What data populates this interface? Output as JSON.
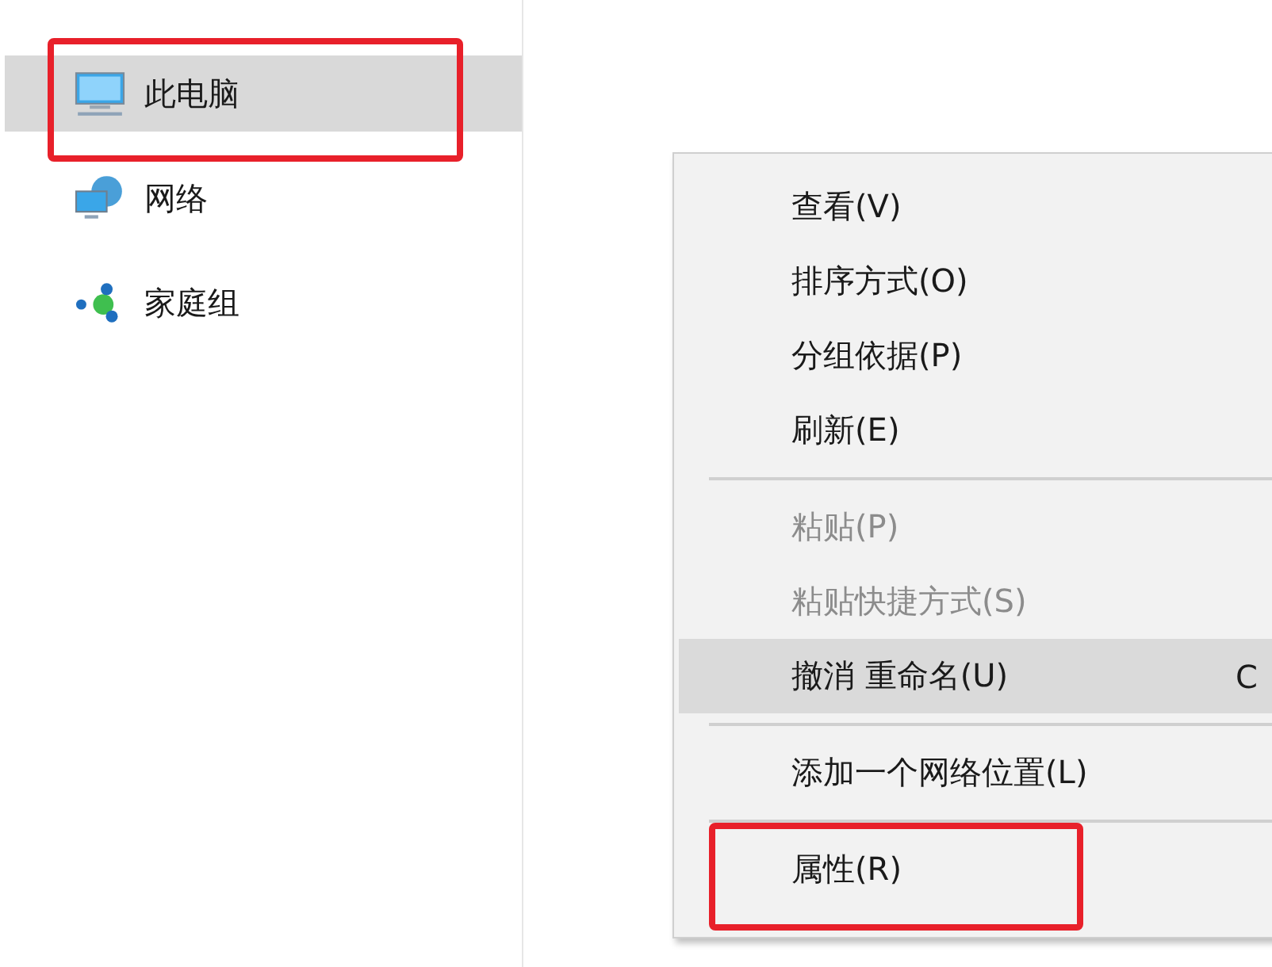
{
  "sidebar": {
    "items": [
      {
        "label": "此电脑",
        "kind": "computer",
        "selected": true,
        "annotated": true
      },
      {
        "label": "网络",
        "kind": "network",
        "selected": false,
        "annotated": false
      },
      {
        "label": "家庭组",
        "kind": "homegroup",
        "selected": false,
        "annotated": false
      }
    ]
  },
  "context_menu": {
    "items": [
      {
        "kind": "item",
        "label": "查看(V)",
        "disabled": false,
        "selected": false,
        "annotated": false
      },
      {
        "kind": "item",
        "label": "排序方式(O)",
        "disabled": false,
        "selected": false,
        "annotated": false
      },
      {
        "kind": "item",
        "label": "分组依据(P)",
        "disabled": false,
        "selected": false,
        "annotated": false
      },
      {
        "kind": "item",
        "label": "刷新(E)",
        "disabled": false,
        "selected": false,
        "annotated": false
      },
      {
        "kind": "separator"
      },
      {
        "kind": "item",
        "label": "粘贴(P)",
        "disabled": true,
        "selected": false,
        "annotated": false
      },
      {
        "kind": "item",
        "label": "粘贴快捷方式(S)",
        "disabled": true,
        "selected": false,
        "annotated": false
      },
      {
        "kind": "item",
        "label": "撤消 重命名(U)",
        "shortcut": "C",
        "disabled": false,
        "selected": true,
        "annotated": false
      },
      {
        "kind": "separator"
      },
      {
        "kind": "item",
        "label": "添加一个网络位置(L)",
        "disabled": false,
        "selected": false,
        "annotated": false
      },
      {
        "kind": "separator"
      },
      {
        "kind": "item",
        "label": "属性(R)",
        "disabled": false,
        "selected": false,
        "annotated": true
      }
    ]
  }
}
